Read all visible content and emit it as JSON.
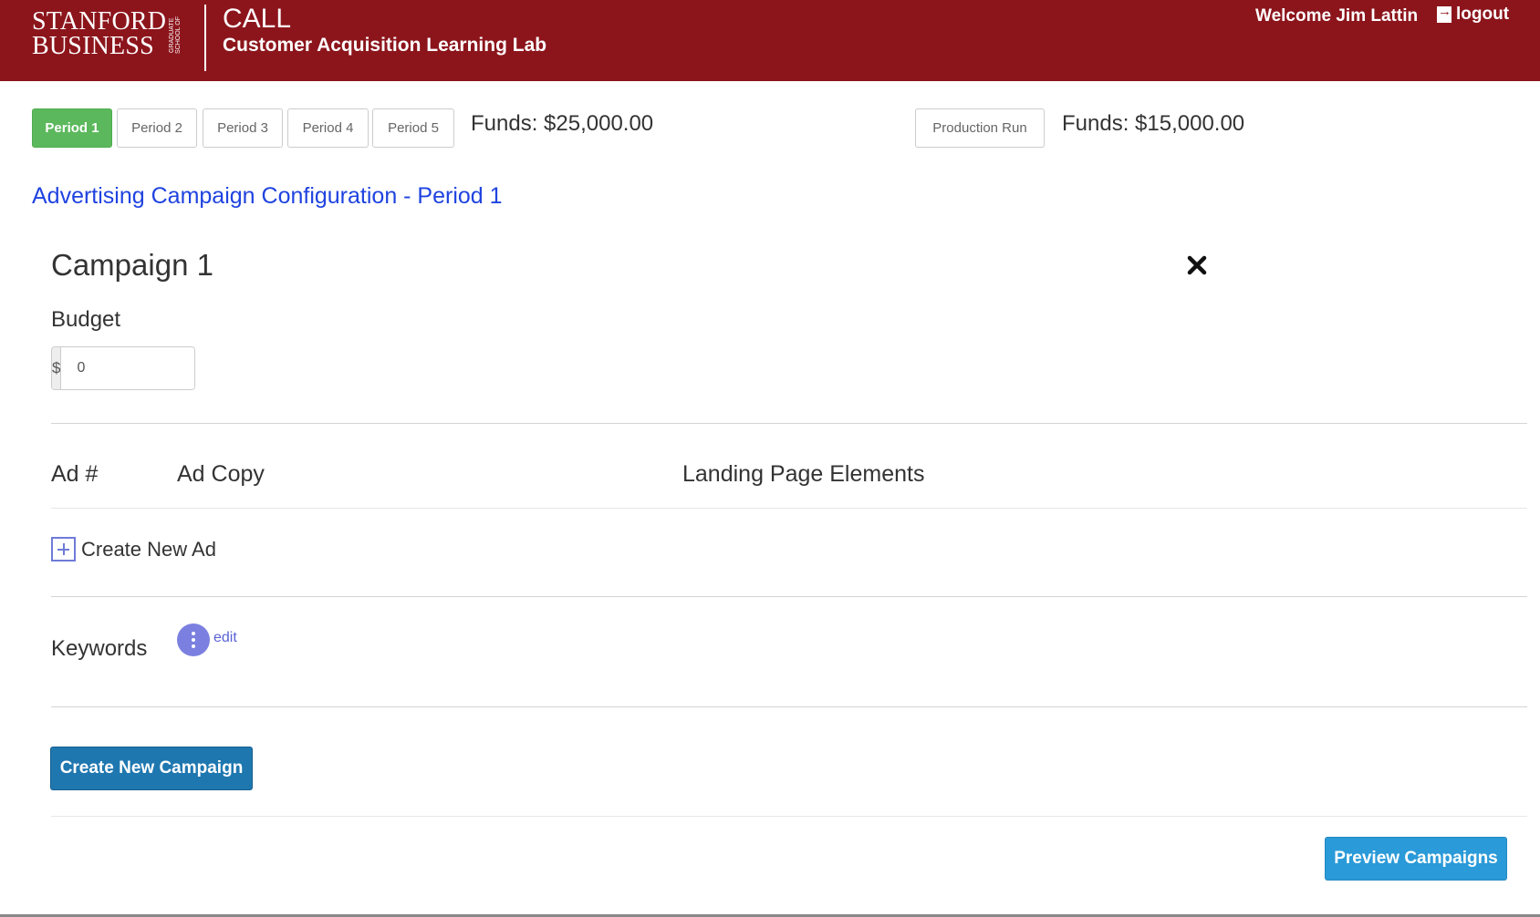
{
  "header": {
    "logo_line1": "STANFORD",
    "logo_line2": "BUSINESS",
    "logo_sub": "GRADUATE SCHOOL OF",
    "app_title": "CALL",
    "app_subtitle": "Customer Acquisition Learning Lab",
    "welcome": "Welcome Jim Lattin",
    "logout": "logout",
    "brand_color": "#8c151c"
  },
  "periods": {
    "tabs": [
      "Period 1",
      "Period 2",
      "Period 3",
      "Period 4",
      "Period 5"
    ],
    "active": "Period 1",
    "funds": "Funds: $25,000.00"
  },
  "production": {
    "button": "Production Run",
    "funds": "Funds: $15,000.00"
  },
  "config_title": "Advertising Campaign Configuration - Period 1",
  "campaign": {
    "title": "Campaign 1",
    "budget_label": "Budget",
    "budget_currency": "$",
    "budget_value": "0",
    "columns": [
      "Ad #",
      "Ad Copy",
      "Landing Page Elements"
    ],
    "create_ad": "Create New Ad",
    "keywords_label": "Keywords",
    "keywords_edit": "edit"
  },
  "actions": {
    "create_campaign": "Create New Campaign",
    "preview_campaigns": "Preview Campaigns"
  },
  "icons": {
    "close": "close-icon",
    "plus": "plus-square-icon",
    "more": "more-vertical-icon",
    "logout": "logout-icon"
  }
}
